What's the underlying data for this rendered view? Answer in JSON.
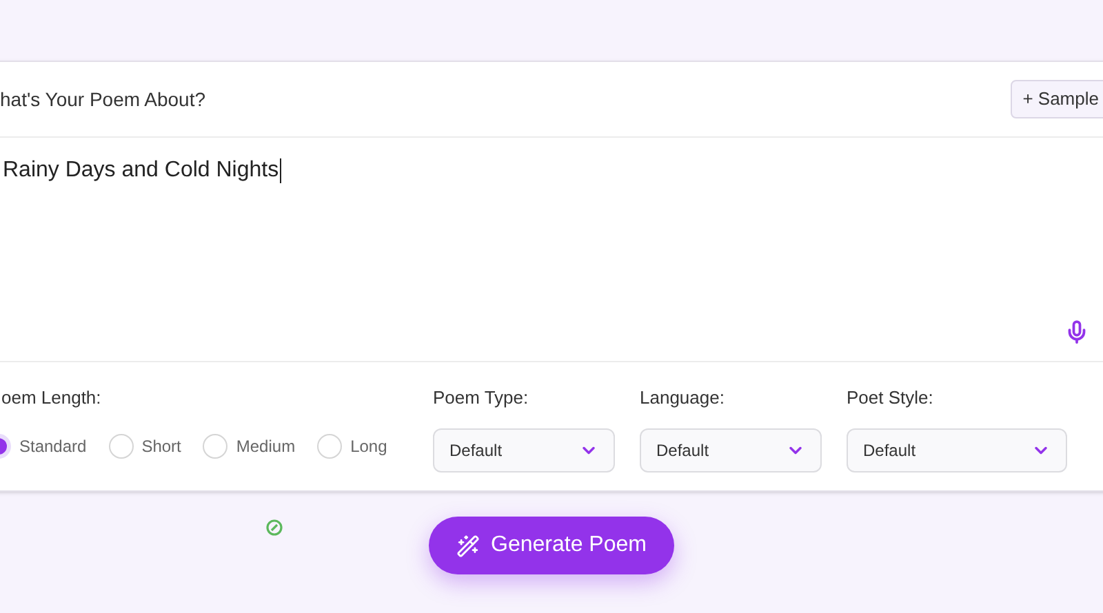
{
  "prompt": {
    "label": "hat's Your Poem About?",
    "sample_button": "+ Sample",
    "value": "Rainy Days and Cold Nights"
  },
  "length": {
    "label": "oem Length:",
    "options": [
      {
        "label": "Standard",
        "selected": true
      },
      {
        "label": "Short",
        "selected": false
      },
      {
        "label": "Medium",
        "selected": false
      },
      {
        "label": "Long",
        "selected": false
      }
    ]
  },
  "selects": [
    {
      "label": "Poem Type:",
      "value": "Default"
    },
    {
      "label": "Language:",
      "value": "Default"
    },
    {
      "label": "Poet Style:",
      "value": "Default"
    }
  ],
  "generate_button": "Generate Poem"
}
